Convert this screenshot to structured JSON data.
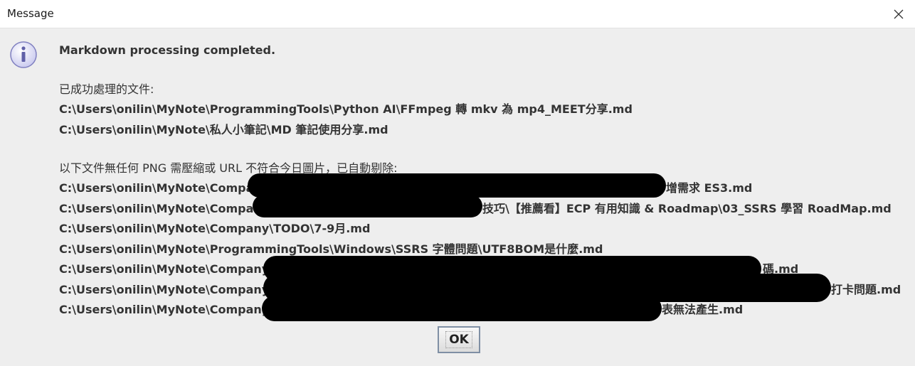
{
  "window": {
    "title": "Message",
    "close_icon": "close-icon"
  },
  "message": {
    "icon": "info-icon",
    "headline": "Markdown processing completed.",
    "success_header": "已成功處理的文件:",
    "success_files": [
      "C:\\Users\\onilin\\MyNote\\ProgrammingTools\\Python AI\\FFmpeg 轉 mkv 為 mp4_MEET分享.md",
      "C:\\Users\\onilin\\MyNote\\私人小筆記\\MD 筆記使用分享.md"
    ],
    "removed_header": "以下文件無任何 PNG 需壓縮或 URL 不符合今日圖片，已自動剔除:",
    "removed_files": [
      "C:\\Users\\onilin\\MyNote\\Compa",
      "增需求 ES3.md",
      "C:\\Users\\onilin\\MyNote\\Compan",
      "技巧\\【推薦看】ECP 有用知識 & Roadmap\\03_SSRS 學習 RoadMap.md",
      "C:\\Users\\onilin\\MyNote\\Company\\TODO\\7-9月.md",
      "C:\\Users\\onilin\\MyNote\\ProgrammingTools\\Windows\\SSRS 字體問題\\UTF8BOM是什麼.md",
      "C:\\Users\\onilin\\MyNote\\Company",
      "碼.md",
      "C:\\Users\\onilin\\MyNote\\Company",
      "打卡問題.md",
      "C:\\Users\\onilin\\MyNote\\Company",
      "表無法產生.md"
    ]
  },
  "buttons": {
    "ok_label": "OK"
  }
}
